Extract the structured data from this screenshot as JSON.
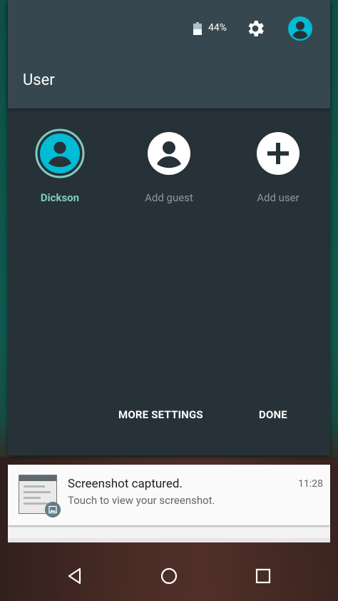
{
  "status_bar": {
    "battery_percent": "44%",
    "battery_level": 0.44,
    "icons": [
      "battery-icon",
      "settings-gear-icon",
      "user-avatar-icon"
    ]
  },
  "header": {
    "title": "User"
  },
  "users": [
    {
      "name": "Dickson",
      "icon": "user-avatar-icon",
      "active": true
    },
    {
      "name": "Add guest",
      "icon": "guest-avatar-icon",
      "active": false
    },
    {
      "name": "Add user",
      "icon": "add-icon",
      "active": false
    }
  ],
  "actions": {
    "more_settings": "MORE SETTINGS",
    "done": "DONE"
  },
  "notification": {
    "title": "Screenshot captured.",
    "text": "Touch to view your screenshot.",
    "time": "11:28",
    "icons": [
      "screenshot-thumbnail",
      "image-icon"
    ]
  },
  "navigation": {
    "icons": [
      "back-icon",
      "home-icon",
      "recents-icon"
    ]
  },
  "colors": {
    "accent": "#00bcd4",
    "shade_bg": "#263238",
    "header_bg": "#37474f",
    "active_label": "#80cbc4"
  }
}
